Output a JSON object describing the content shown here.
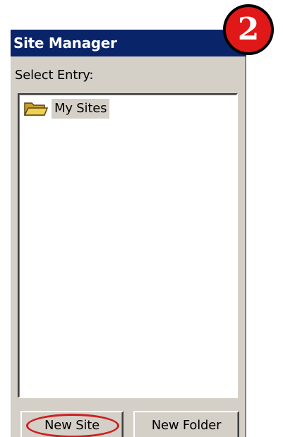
{
  "window": {
    "title": "Site Manager"
  },
  "tree": {
    "label": "Select Entry:",
    "items": [
      {
        "label": "My Sites",
        "icon": "folder-open-icon",
        "selected": true
      }
    ]
  },
  "buttons": {
    "new_site": "New Site",
    "new_folder": "New Folder"
  },
  "annotation": {
    "step_number": "2",
    "badge_color": "#e01818",
    "highlight_color": "#cc2020"
  },
  "colors": {
    "titlebar": "#0a246a",
    "window_bg": "#d4d0c8",
    "selection_bg": "#d4d0c8"
  }
}
